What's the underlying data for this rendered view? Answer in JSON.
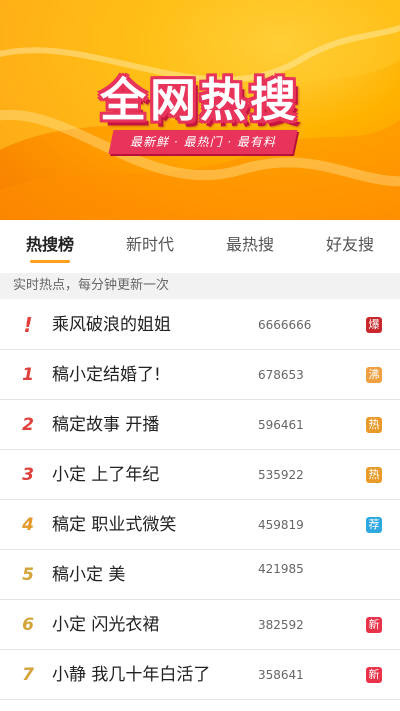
{
  "banner": {
    "title": "全网热搜",
    "subtitle": "最新鲜 · 最热门 · 最有料"
  },
  "tabs": [
    {
      "label": "热搜榜",
      "active": true
    },
    {
      "label": "新时代",
      "active": false
    },
    {
      "label": "最热搜",
      "active": false
    },
    {
      "label": "好友搜",
      "active": false
    }
  ],
  "notice": "实时热点，每分钟更新一次",
  "colors": {
    "accent_orange": "#ff9f1c",
    "rank_red": "#e0403b",
    "rank_orange": "#e39a2a",
    "rank_gold": "#d4a33a",
    "badge_explode": "#c8282c",
    "badge_boil": "#f0a040",
    "badge_hot": "#e89a2a",
    "badge_recommend": "#2fa8e0",
    "badge_new": "#e8334a"
  },
  "list": [
    {
      "rank": "!",
      "title": "乘风破浪的姐姐",
      "count": "6666666",
      "badge": "爆",
      "badge_icon": "explode-badge-icon"
    },
    {
      "rank": "1",
      "title": "稿小定结婚了!",
      "count": "678653",
      "badge": "沸",
      "badge_icon": "boil-badge-icon"
    },
    {
      "rank": "2",
      "title": "稿定故事 开播",
      "count": "596461",
      "badge": "热",
      "badge_icon": "hot-badge-icon"
    },
    {
      "rank": "3",
      "title": "小定  上了年纪",
      "count": "535922",
      "badge": "热",
      "badge_icon": "hot-badge-icon"
    },
    {
      "rank": "4",
      "title": "稿定  职业式微笑",
      "count": "459819",
      "badge": "荐",
      "badge_icon": "recommend-badge-icon"
    },
    {
      "rank": "5",
      "title": "稿小定  美",
      "count": "421985",
      "badge": "",
      "badge_icon": ""
    },
    {
      "rank": "6",
      "title": "小定  闪光衣裙",
      "count": "382592",
      "badge": "新",
      "badge_icon": "new-badge-icon"
    },
    {
      "rank": "7",
      "title": "小静  我几十年白活了",
      "count": "358641",
      "badge": "新",
      "badge_icon": "new-badge-icon"
    }
  ]
}
